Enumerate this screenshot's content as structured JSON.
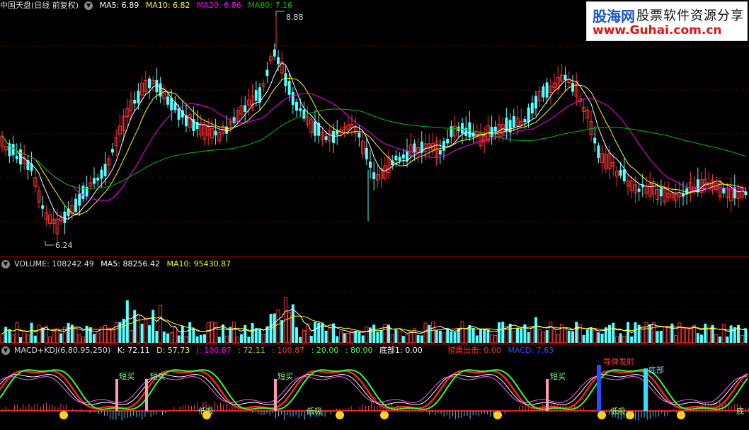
{
  "price_panel": {
    "title": "中国天盘(日线 前复权)",
    "ma5": "MA5: 6.89",
    "ma10": "MA10: 6.82",
    "ma20": "MA20: 6.86",
    "ma60": "MA60: 7.16",
    "high_label": "8.88",
    "low_label": "6.24"
  },
  "volume_panel": {
    "title": "VOLUME: 108242.49",
    "ma5": "MA5: 88256.42",
    "ma10": "MA10: 95430.87"
  },
  "indicator_panel": {
    "title": "MACD+KDJ(6,80,95,250)",
    "k": "K: 72.11",
    "d": "D: 57.73",
    "j": "J: 100.87",
    "v1": ": 72.11",
    "v2": ": 100.87",
    "v3": ": 20.00",
    "v4": ": 80.00",
    "bottom1": "底部1: 0.00",
    "eagle": "猎鹰出击: 0.00",
    "macd": "MACD: 7.63",
    "signals": [
      "短买",
      "短买",
      "短买",
      "短买",
      "导弹发射",
      "底部",
      "低吸",
      "低吸",
      "低吸",
      "底"
    ]
  },
  "watermark": {
    "line1a": "股海网",
    "line1b": "股票软件资源分享",
    "line2": "www.Guhai.com.cn"
  },
  "colors": {
    "up": "#ff3232",
    "down": "#54ffff",
    "ma5": "#ffffff",
    "ma10": "#ffff00",
    "ma20": "#ff00ff",
    "ma60": "#00c000",
    "separator": "#b00000"
  }
}
